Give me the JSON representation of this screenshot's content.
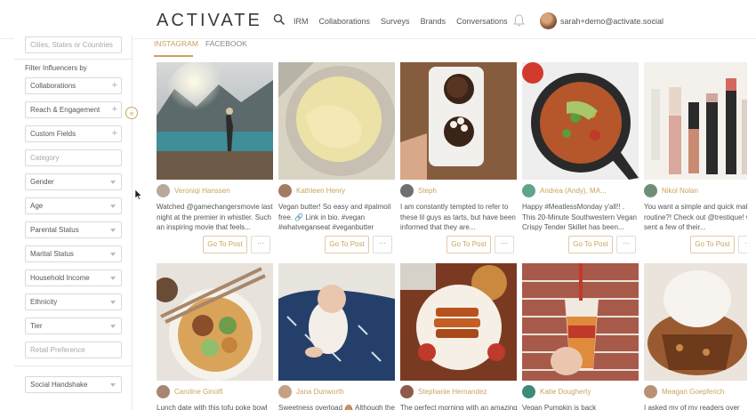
{
  "header": {
    "logo": "ACTIVATE",
    "nav": [
      "IRM",
      "Collaborations",
      "Surveys",
      "Brands",
      "Conversations"
    ],
    "user_email": "sarah+demo@activate.social"
  },
  "sidebar": {
    "location_placeholder": "Cities, States or Countries",
    "filter_title": "Filter Influencers by",
    "filters": [
      {
        "label": "Collaborations",
        "kind": "plus"
      },
      {
        "label": "Reach & Engagement",
        "kind": "plus"
      },
      {
        "label": "Custom Fields",
        "kind": "plus"
      },
      {
        "label": "Category",
        "kind": "placeholder"
      },
      {
        "label": "Gender",
        "kind": "caret"
      },
      {
        "label": "Age",
        "kind": "caret"
      },
      {
        "label": "Parental Status",
        "kind": "caret"
      },
      {
        "label": "Marital Status",
        "kind": "caret"
      },
      {
        "label": "Household Income",
        "kind": "caret"
      },
      {
        "label": "Ethnicity",
        "kind": "caret"
      },
      {
        "label": "Tier",
        "kind": "caret"
      },
      {
        "label": "Retail Preference",
        "kind": "placeholder"
      }
    ],
    "social_handshake": "Social Handshake"
  },
  "tabs": {
    "instagram": "INSTAGRAM",
    "facebook": "FACEBOOK"
  },
  "posts_row1": [
    {
      "author": "Veroniqi Hanssen",
      "caption": "Watched @gamechangersmovie last night at the premier in whistler. Such an inspiring movie that feels..."
    },
    {
      "author": "Kathleen Henry",
      "caption": "Vegan butter! So easy and #palmoil free. 🔗 Link in bio. #vegan #whatveganseat #veganbutter"
    },
    {
      "author": "Steph",
      "caption": "I am constantly tempted to refer to these lil guys as tarts, but have been informed that they are..."
    },
    {
      "author": "Andrea (Andy), MA...",
      "caption": "Happy #MeatlessMonday y'all!! . This 20-Minute Southwestern Vegan Crispy Tender Skillet has been..."
    },
    {
      "author": "Nikol Nolan",
      "caption": "You want a simple and quick make routine?! Check out @trestique! was sent a few of their..."
    }
  ],
  "posts_row2": [
    {
      "author": "Caroline Ginolfi",
      "caption": "Lunch date with this tofu poke bowl"
    },
    {
      "author": "Jana Dunworth",
      "caption": "Sweetness overload 🙈 Although these"
    },
    {
      "author": "Stephanie Hernandez",
      "caption": "The perfect morning with an amazing"
    },
    {
      "author": "Katie Dougherty",
      "caption": "Vegan Pumpkin is back"
    },
    {
      "author": "Meagan Goepferich",
      "caption": "I asked my of my readers over"
    }
  ],
  "buttons": {
    "go_to_post": "Go To Post",
    "more": "···"
  }
}
